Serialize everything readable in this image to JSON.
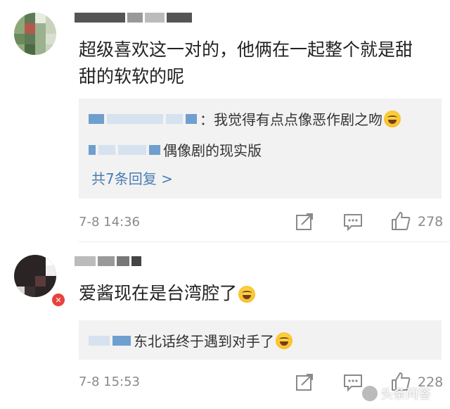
{
  "comments": [
    {
      "text": "超级喜欢这一对的，他俩在一起整个就是甜甜的软软的呢",
      "text_line1": "超级喜欢这一对的，他俩在一起整个就是甜",
      "text_line2": "甜的软软的呢",
      "replies": [
        {
          "text": "：我觉得有点点像恶作剧之吻",
          "has_emoji": true,
          "emoji_icon": "laughing-crying-emoji"
        },
        {
          "text": "偶像剧的现实版"
        }
      ],
      "more_replies": "共7条回复 >",
      "time": "7-8 14:36",
      "likes": "278"
    },
    {
      "text": "爱酱现在是台湾腔了",
      "has_emoji": true,
      "replies": [
        {
          "text": "东北话终于遇到对手了",
          "has_emoji": true
        }
      ],
      "time": "7-8 15:53",
      "likes": "228"
    }
  ],
  "icons": {
    "share": "share-icon",
    "comment": "comment-icon",
    "like": "like-icon",
    "verified": "verified-badge-icon"
  },
  "watermark": "头条问答",
  "colors": {
    "link": "#4a7db4",
    "meta": "#8a8a8a",
    "reply_bg": "#f2f2f2",
    "badge": "#e8423c"
  }
}
